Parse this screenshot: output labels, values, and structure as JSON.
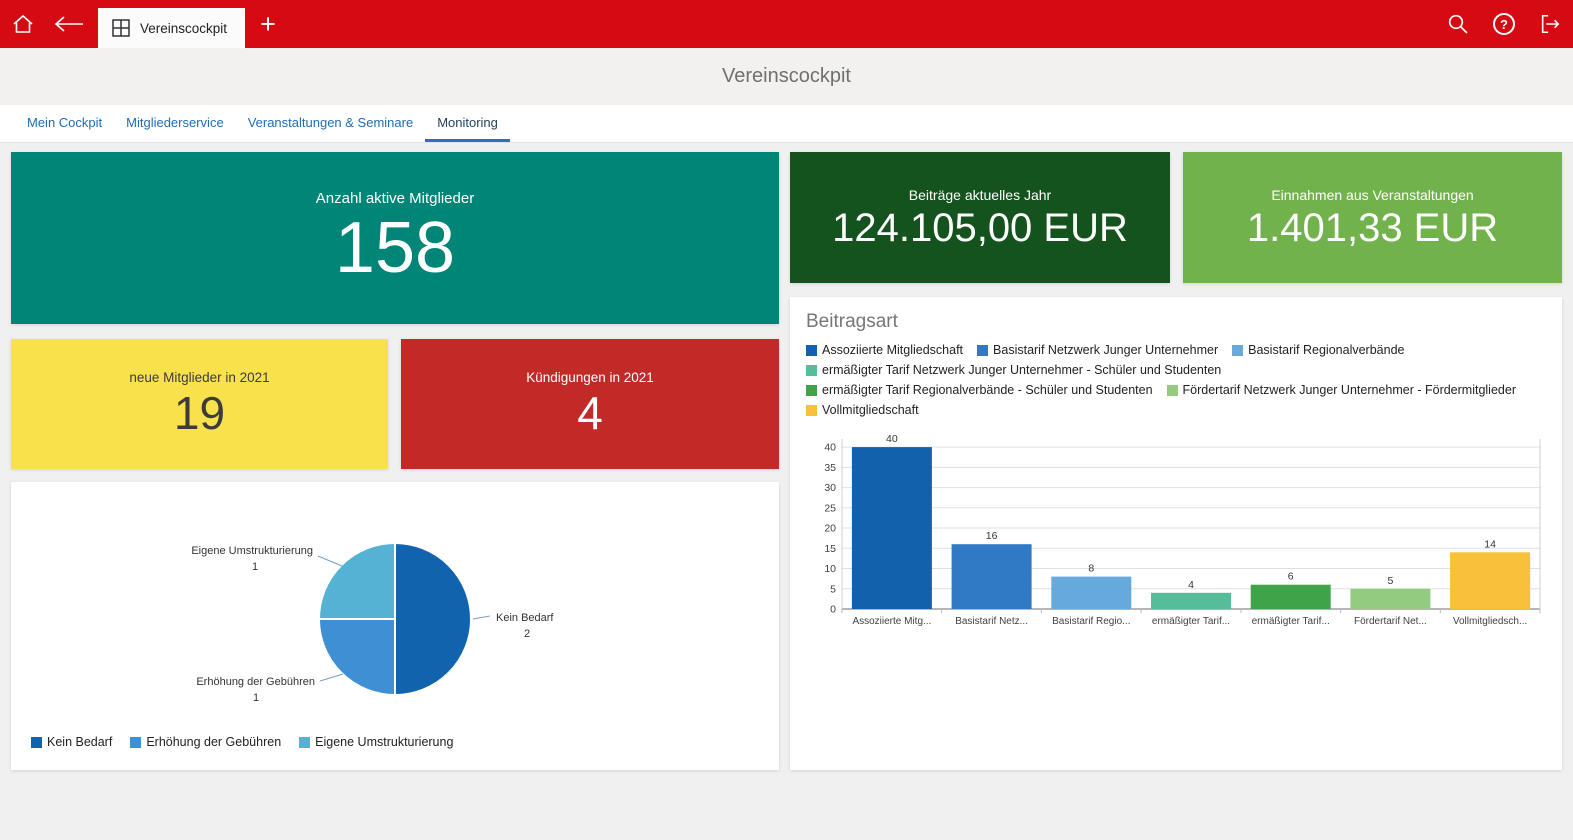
{
  "topbar": {
    "tab_label": "Vereinscockpit",
    "color": "#d60a12"
  },
  "icons": {
    "plus": "+",
    "help": "?"
  },
  "page": {
    "title": "Vereinscockpit"
  },
  "tabs": [
    {
      "label": "Mein Cockpit",
      "active": false
    },
    {
      "label": "Mitgliederservice",
      "active": false
    },
    {
      "label": "Veranstaltungen & Seminare",
      "active": false
    },
    {
      "label": "Monitoring",
      "active": true
    }
  ],
  "kpis": {
    "active_members": {
      "label": "Anzahl aktive Mitglieder",
      "value": "158",
      "bg": "#008577"
    },
    "new_members": {
      "label": "neue Mitglieder in 2021",
      "value": "19",
      "bg": "#f8e14b"
    },
    "cancellations": {
      "label": "Kündigungen in 2021",
      "value": "4",
      "bg": "#c22a28"
    },
    "fees_year": {
      "label": "Beiträge aktuelles Jahr",
      "value": "124.105,00 EUR",
      "bg": "#14531d"
    },
    "event_income": {
      "label": "Einnahmen aus Veranstaltungen",
      "value": "1.401,33 EUR",
      "bg": "#71b24c"
    }
  },
  "chart_data": [
    {
      "type": "pie",
      "name": "mitglieder-umstrukturierung",
      "slices": [
        {
          "label": "Kein Bedarf",
          "value": 2,
          "color": "#1263ae"
        },
        {
          "label": "Erhöhung der Gebühren",
          "value": 1,
          "color": "#3f8fd4"
        },
        {
          "label": "Eigene Umstrukturierung",
          "value": 1,
          "color": "#54b2d4"
        }
      ],
      "legend": [
        "Kein Bedarf",
        "Erhöhung der Gebühren",
        "Eigene Umstrukturierung"
      ],
      "legend_position": "bottom"
    },
    {
      "type": "bar",
      "title": "Beitragsart",
      "series": [
        {
          "name": "Assoziierte Mitgliedschaft",
          "value": 40,
          "color": "#1161ac"
        },
        {
          "name": "Basistarif Netzwerk Junger Unternehmer",
          "value": 16,
          "color": "#3079c4"
        },
        {
          "name": "Basistarif Regionalverbände",
          "value": 8,
          "color": "#66aadd"
        },
        {
          "name": "ermäßigter Tarif Netzwerk Junger Unternehmer - Schüler und Studenten",
          "value": 4,
          "color": "#55bd99"
        },
        {
          "name": "ermäßigter Tarif Regionalverbände - Schüler und Studenten",
          "value": 6,
          "color": "#3fa449"
        },
        {
          "name": "Fördertarif Netzwerk Junger Unternehmer - Fördermitglieder",
          "value": 5,
          "color": "#93cb80"
        },
        {
          "name": "Vollmitgliedschaft",
          "value": 14,
          "color": "#f9c13a"
        }
      ],
      "categories_short": [
        "Assoziierte Mitg...",
        "Basistarif Netz...",
        "Basistarif Regio...",
        "ermäßigter Tarif...",
        "ermäßigter Tarif...",
        "Fördertarif Net...",
        "Vollmitgliedsch..."
      ],
      "ylim": [
        0,
        42
      ],
      "yticks": [
        0,
        5,
        10,
        15,
        20,
        25,
        30,
        35,
        40
      ],
      "legend_position": "top",
      "grid": true
    }
  ]
}
